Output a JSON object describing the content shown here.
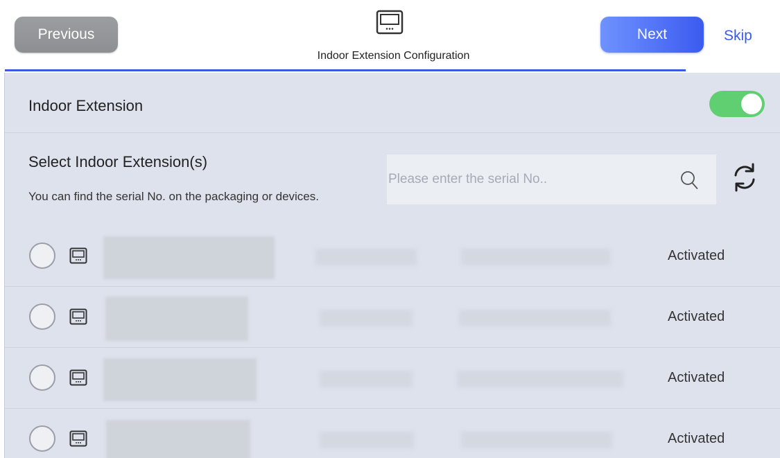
{
  "header": {
    "previous_label": "Previous",
    "title": "Indoor Extension Configuration",
    "next_label": "Next",
    "skip_label": "Skip",
    "icon": "indoor-monitor-icon"
  },
  "colors": {
    "accent": "#3b5bef",
    "toggle_on": "#5fcf72",
    "content_bg": "#dde2ec",
    "previous_button": "#949599"
  },
  "indoor_extension": {
    "label": "Indoor Extension",
    "enabled": true
  },
  "select_section": {
    "title": "Select Indoor Extension(s)",
    "hint": "You can find the serial No. on the packaging or devices.",
    "search_placeholder": "Please enter the serial No..",
    "search_value": ""
  },
  "devices": [
    {
      "icon": "indoor-monitor-icon",
      "selected": false,
      "status": "Activated"
    },
    {
      "icon": "indoor-monitor-icon",
      "selected": false,
      "status": "Activated"
    },
    {
      "icon": "indoor-monitor-icon",
      "selected": false,
      "status": "Activated"
    },
    {
      "icon": "indoor-monitor-icon",
      "selected": false,
      "status": "Activated"
    }
  ]
}
